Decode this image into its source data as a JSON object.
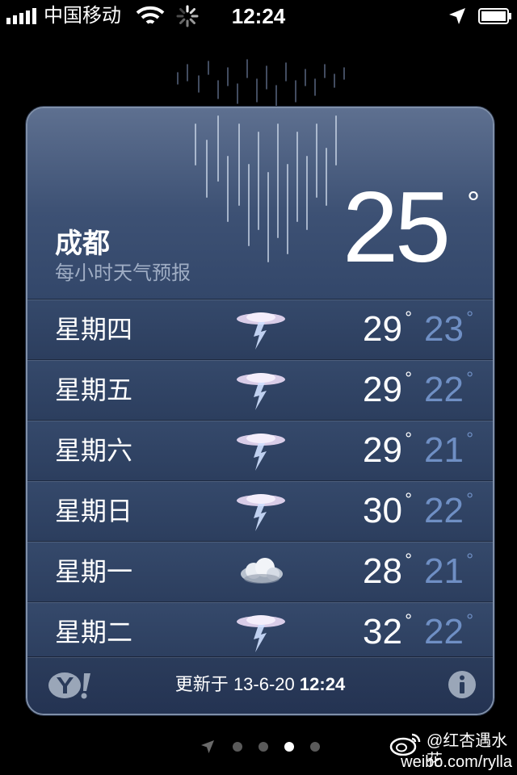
{
  "status_bar": {
    "carrier": "中国移动",
    "time": "12:24",
    "icons": [
      "signal-bars-icon",
      "wifi-icon",
      "activity-spinner-icon",
      "location-arrow-icon",
      "battery-icon"
    ]
  },
  "weather": {
    "city": "成都",
    "subtitle": "每小时天气预报",
    "current_temp": "25",
    "degree_symbol": "°",
    "forecast": [
      {
        "day": "星期四",
        "icon": "thunderstorm-icon",
        "high": "29",
        "low": "23"
      },
      {
        "day": "星期五",
        "icon": "thunderstorm-icon",
        "high": "29",
        "low": "22"
      },
      {
        "day": "星期六",
        "icon": "thunderstorm-icon",
        "high": "29",
        "low": "21"
      },
      {
        "day": "星期日",
        "icon": "thunderstorm-icon",
        "high": "30",
        "low": "22"
      },
      {
        "day": "星期一",
        "icon": "cloudy-icon",
        "high": "28",
        "low": "21"
      },
      {
        "day": "星期二",
        "icon": "thunderstorm-icon",
        "high": "32",
        "low": "22"
      }
    ],
    "footer": {
      "updated_label": "更新于",
      "updated_date": "13-6-20",
      "updated_time": "12:24",
      "provider_icon": "yahoo-logo-icon",
      "info_icon": "info-icon"
    }
  },
  "pager": {
    "page_count": 4,
    "active_index": 2,
    "icons": [
      "location-arrow-icon"
    ]
  },
  "watermark": {
    "handle": "@红杏遇水花",
    "url": "weibo.com/rylla",
    "icon": "weibo-logo-icon"
  },
  "colors": {
    "low_temp": "#6f8fc4",
    "card_bg": "#2f4364",
    "subtitle": "#9fadc4"
  }
}
